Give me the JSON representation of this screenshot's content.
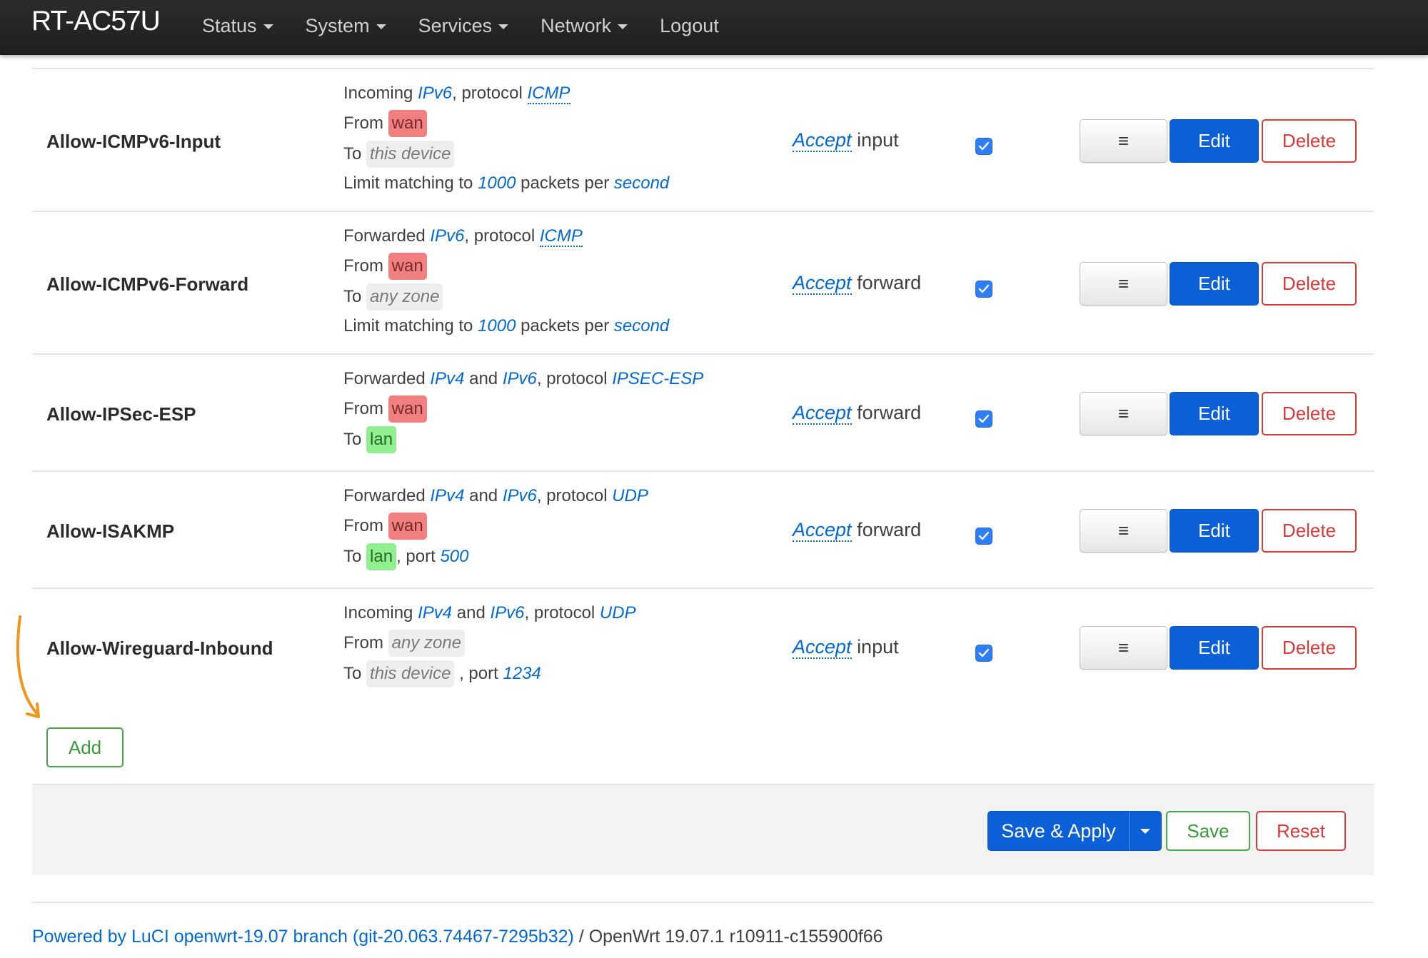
{
  "header": {
    "brand": "RT-AC57U",
    "menu": [
      {
        "label": "Status",
        "dropdown": true
      },
      {
        "label": "System",
        "dropdown": true
      },
      {
        "label": "Services",
        "dropdown": true
      },
      {
        "label": "Network",
        "dropdown": true
      },
      {
        "label": "Logout",
        "dropdown": false
      }
    ]
  },
  "rules": [
    {
      "name": "Allow-ICMPv6-Input",
      "match": {
        "direction": "Incoming",
        "families": [
          "IPv6"
        ],
        "protocol_word": "protocol",
        "protocol": "ICMP",
        "from_label": "From",
        "from_zone": "wan",
        "to_label": "To",
        "to_zone": "this device",
        "to_suffix": "",
        "port_label": "",
        "port": "",
        "limit_prefix": "Limit matching to",
        "limit_value": "1000",
        "limit_mid": "packets per",
        "limit_unit": "second"
      },
      "action_verb": "Accept",
      "action_target": "input",
      "enabled": true,
      "buttons": {
        "sort": "≡",
        "edit": "Edit",
        "delete": "Delete"
      }
    },
    {
      "name": "Allow-ICMPv6-Forward",
      "match": {
        "direction": "Forwarded",
        "families": [
          "IPv6"
        ],
        "protocol_word": "protocol",
        "protocol": "ICMP",
        "from_label": "From",
        "from_zone": "wan",
        "to_label": "To",
        "to_zone": "any zone",
        "to_suffix": "",
        "port_label": "",
        "port": "",
        "limit_prefix": "Limit matching to",
        "limit_value": "1000",
        "limit_mid": "packets per",
        "limit_unit": "second"
      },
      "action_verb": "Accept",
      "action_target": "forward",
      "enabled": true,
      "buttons": {
        "sort": "≡",
        "edit": "Edit",
        "delete": "Delete"
      }
    },
    {
      "name": "Allow-IPSec-ESP",
      "match": {
        "direction": "Forwarded",
        "families": [
          "IPv4",
          "IPv6"
        ],
        "family_joiner": "and",
        "protocol_word": "protocol",
        "protocol": "IPSEC-ESP",
        "from_label": "From",
        "from_zone": "wan",
        "to_label": "To",
        "to_zone": "lan",
        "port_label": "",
        "port": ""
      },
      "action_verb": "Accept",
      "action_target": "forward",
      "enabled": true,
      "buttons": {
        "sort": "≡",
        "edit": "Edit",
        "delete": "Delete"
      }
    },
    {
      "name": "Allow-ISAKMP",
      "match": {
        "direction": "Forwarded",
        "families": [
          "IPv4",
          "IPv6"
        ],
        "family_joiner": "and",
        "protocol_word": "protocol",
        "protocol": "UDP",
        "from_label": "From",
        "from_zone": "wan",
        "to_label": "To",
        "to_zone": "lan",
        "port_label": ", port",
        "port": "500"
      },
      "action_verb": "Accept",
      "action_target": "forward",
      "enabled": true,
      "buttons": {
        "sort": "≡",
        "edit": "Edit",
        "delete": "Delete"
      }
    },
    {
      "name": "Allow-Wireguard-Inbound",
      "match": {
        "direction": "Incoming",
        "families": [
          "IPv4",
          "IPv6"
        ],
        "family_joiner": "and",
        "protocol_word": "protocol",
        "protocol": "UDP",
        "from_label": "From",
        "from_zone": "any zone",
        "to_label": "To",
        "to_zone": "this device",
        "port_label": ", port",
        "port": "1234"
      },
      "action_verb": "Accept",
      "action_target": "input",
      "enabled": true,
      "buttons": {
        "sort": "≡",
        "edit": "Edit",
        "delete": "Delete"
      }
    }
  ],
  "add_button": "Add",
  "actionbar": {
    "save_apply": "Save & Apply",
    "save": "Save",
    "reset": "Reset"
  },
  "footer": {
    "link_text": "Powered by LuCI openwrt-19.07 branch (git-20.063.74467-7295b32)",
    "separator": " / ",
    "version": "OpenWrt 19.07.1 r10911-c155900f66"
  },
  "colors": {
    "header_bg": "#1f1f1f",
    "link": "#0069d6",
    "primary_button": "#0b60d8",
    "danger": "#d93a3a",
    "success": "#48a848",
    "zone_wan": "#f08080",
    "zone_lan": "#90f090",
    "zone_neutral": "#eeeeee",
    "annotation_arrow": "#f0961e"
  },
  "icons": {
    "sort_handle": "hamburger-icon",
    "menu_caret": "caret-down-icon",
    "checkbox": "checkmark-icon",
    "annotation": "curved-arrow-icon"
  }
}
